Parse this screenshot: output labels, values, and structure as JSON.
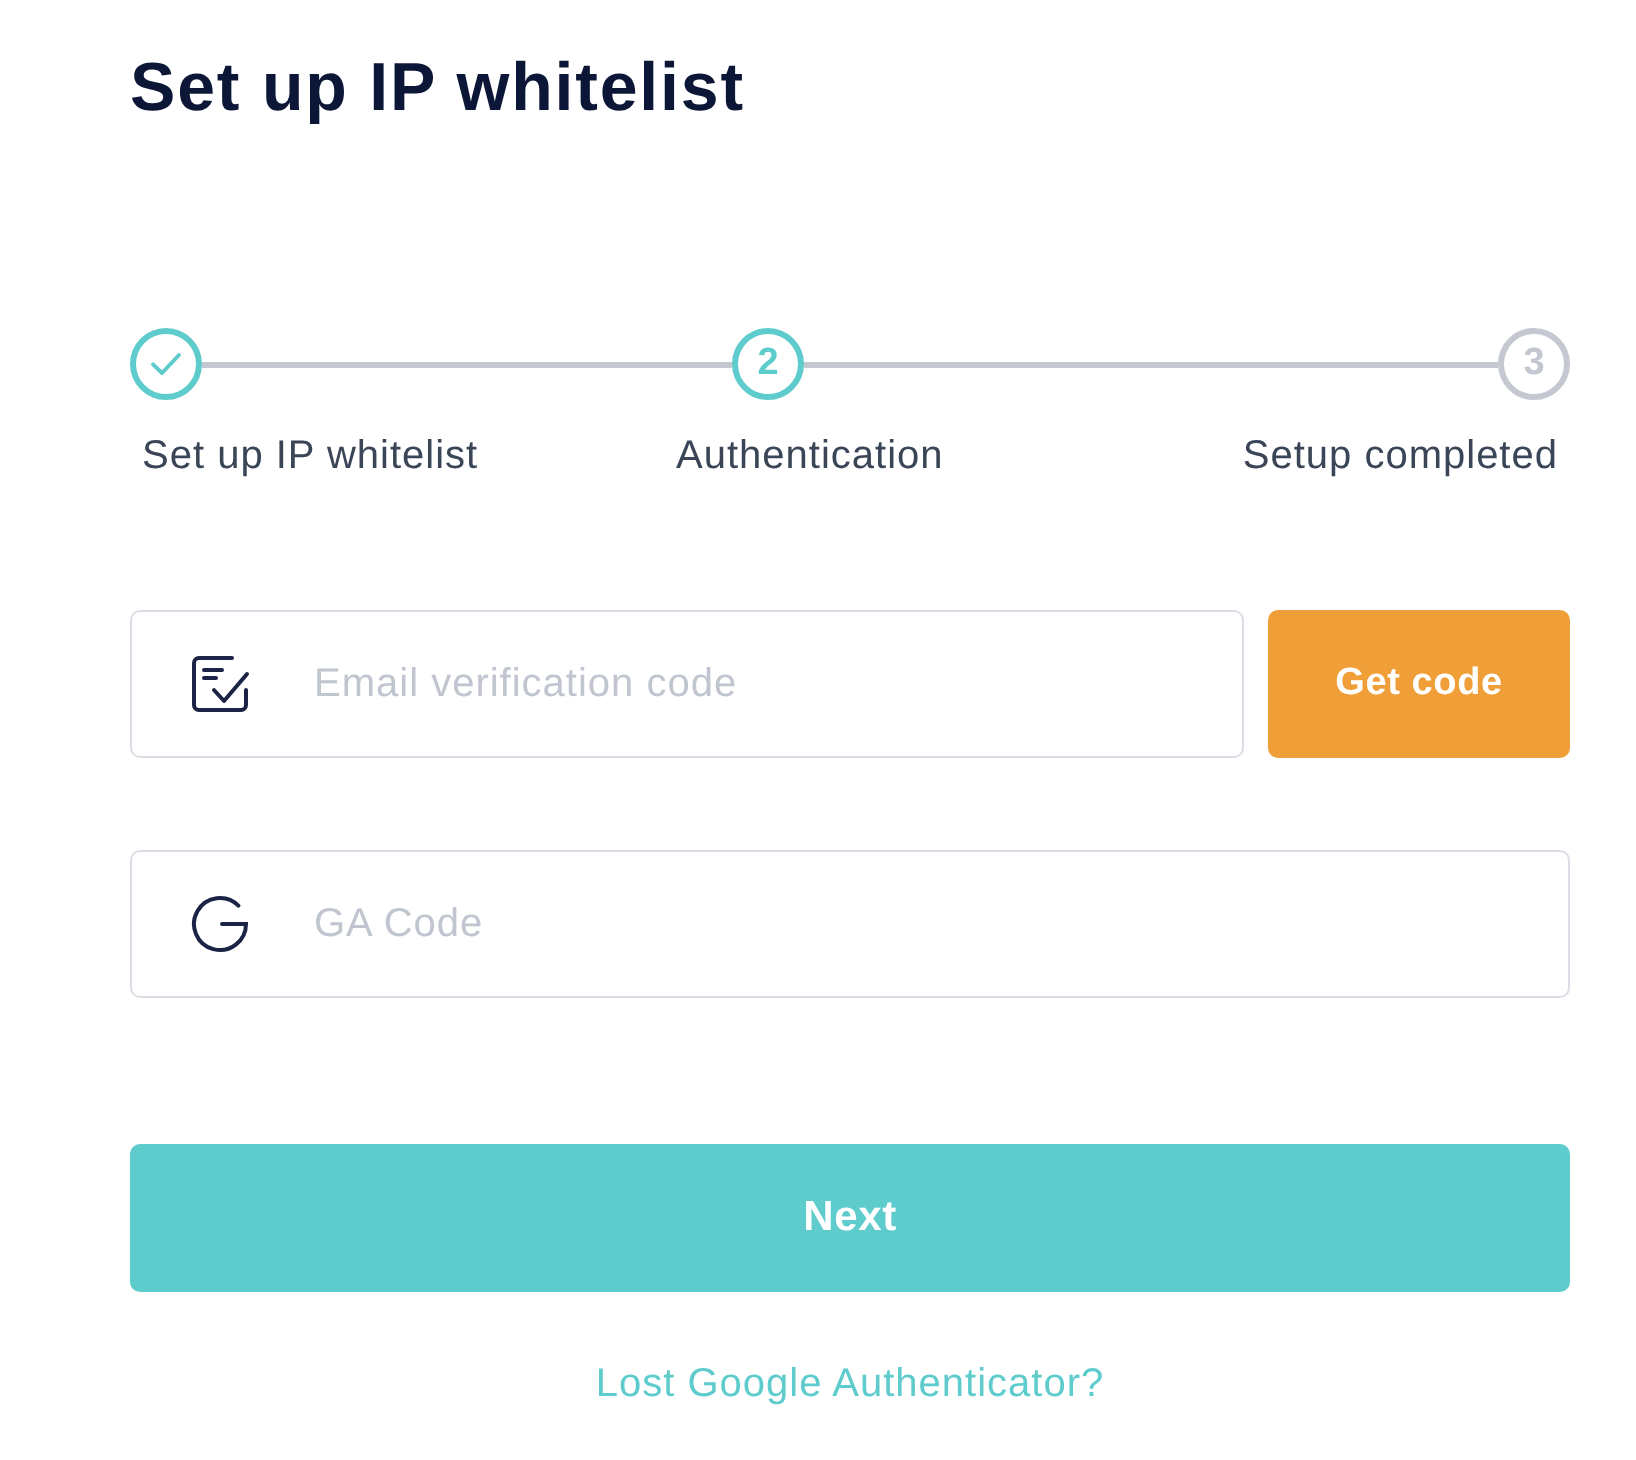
{
  "title": "Set up IP whitelist",
  "steps": [
    {
      "label": "Set up IP whitelist",
      "done": true,
      "highlighted": true
    },
    {
      "number": "2",
      "label": "Authentication",
      "done": false,
      "highlighted": true
    },
    {
      "number": "3",
      "label": "Setup completed",
      "done": false,
      "highlighted": false
    }
  ],
  "fields": [
    {
      "kind": "email",
      "placeholder": "Email verification code",
      "button": "Get code"
    },
    {
      "kind": "ga",
      "placeholder": "GA Code"
    }
  ],
  "next_button": "Next",
  "link": "Lost Google Authenticator?"
}
